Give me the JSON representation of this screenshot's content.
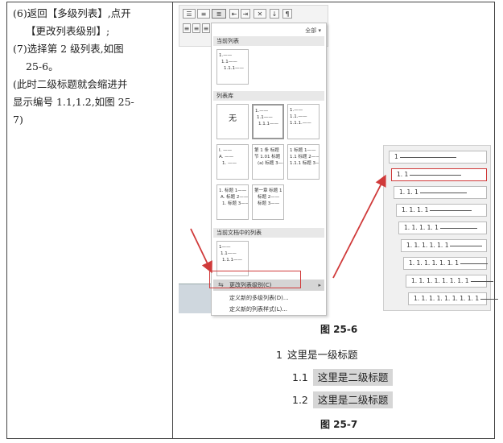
{
  "steps": {
    "s6_a": "(6)返回【多级列表】,点开",
    "s6_b": "【更改列表级别】;",
    "s7_a": "(7)选择第 2 级列表,如图",
    "s7_b": "25-6。",
    "note_a": "(此时二级标题就会缩进并",
    "note_b": "显示编号 1.1,1.2,如图 25-",
    "note_c": "7)"
  },
  "dropdown": {
    "filter_label": "全部 ▾",
    "section_current": "当前列表",
    "section_library": "列表库",
    "section_in_doc": "当前文档中的列表",
    "none_label": "无",
    "thumb_current": [
      "1.——",
      "1.1——",
      "1.1.1——"
    ],
    "thumb_lib1": [
      "1.——",
      "1.1——",
      "1.1.1——"
    ],
    "thumb_lib2": [
      "1.——",
      "1.1.——",
      "1.1.1.——"
    ],
    "thumb_lib3": [
      "I. ——",
      "A. ——",
      "1. ——"
    ],
    "thumb_lib4": [
      "第 1 条 标题",
      "节 1.01 标题",
      "(a) 标题 3——"
    ],
    "thumb_lib5": [
      "1 标题 1——",
      "1.1 标题 2——",
      "1.1.1 标题 3—"
    ],
    "thumb_lib6": [
      "1. 标题 1——",
      "A. 标题 2——",
      "1. 标题 3——"
    ],
    "thumb_lib7": [
      "第一章 标题 1",
      "标题 2——",
      "标题 3——"
    ],
    "thumb_doc": [
      "1——",
      "1.1——",
      "1.1.1——"
    ],
    "menu_change_level": "更改列表级别(C)",
    "menu_define_multilevel": "定义新的多级列表(D)...",
    "menu_define_style": "定义新的列表样式(L)..."
  },
  "levels": [
    "1",
    "1. 1",
    "1. 1. 1",
    "1. 1. 1. 1",
    "1. 1. 1. 1. 1",
    "1. 1. 1. 1. 1. 1",
    "1. 1. 1. 1. 1. 1. 1",
    "1. 1. 1. 1. 1. 1. 1. 1",
    "1. 1. 1. 1. 1. 1. 1. 1. 1"
  ],
  "selected_level_index": 1,
  "figure_25_6": "图 25-6",
  "figure_25_7": "图 25-7",
  "sample": {
    "h1_num": "1",
    "h1_text": "这里是一级标题",
    "h2a_num": "1.1",
    "h2a_text": "这里是二级标题",
    "h2b_num": "1.2",
    "h2b_text": "这里是二级标题"
  },
  "colors": {
    "highlight_red": "#d03a3a",
    "shade_gray": "#d6d6d6"
  }
}
